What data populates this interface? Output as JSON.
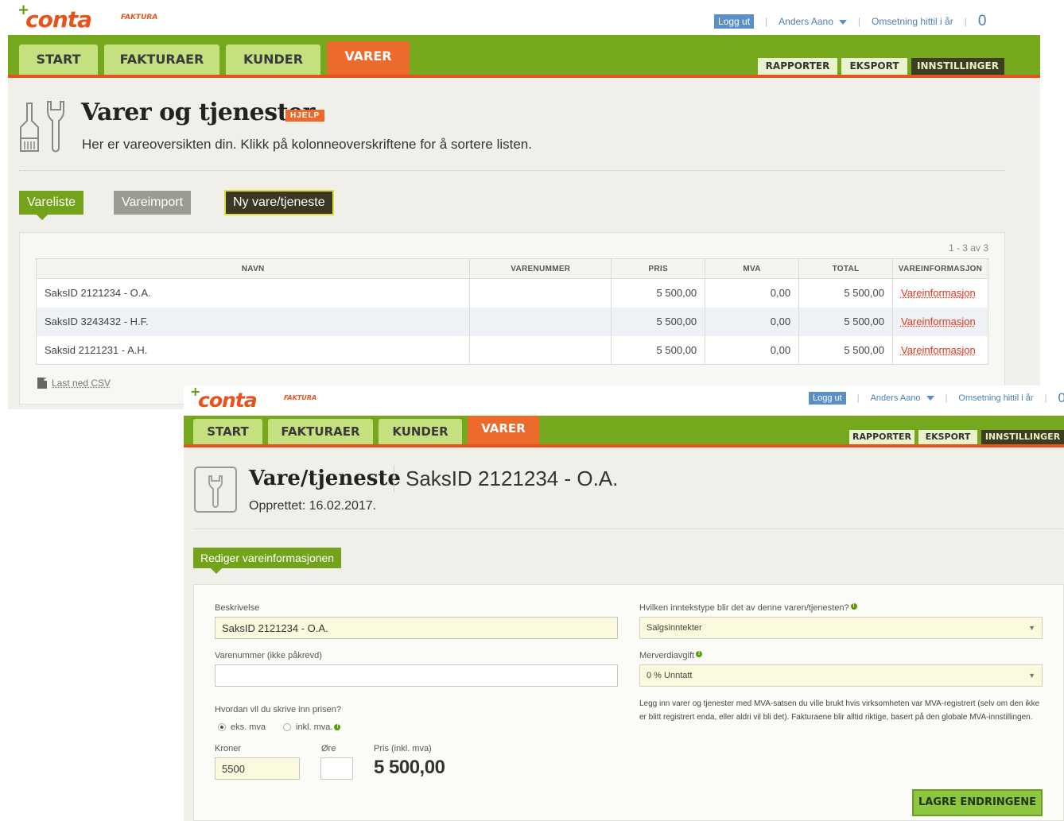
{
  "brand": {
    "logo_text": "conta",
    "logo_sub": "FAKTURA",
    "plus": "+"
  },
  "top": {
    "logout": "Logg ut",
    "user": "Anders Aano",
    "revenue_label": "Omsetning hittil i år",
    "revenue_count": "0"
  },
  "nav": {
    "tabs": [
      "START",
      "FAKTURAER",
      "KUNDER",
      "VARER"
    ],
    "active": "VARER",
    "right_tabs": [
      "RAPPORTER",
      "EKSPORT",
      "INNSTILLINGER"
    ]
  },
  "list_page": {
    "title": "Varer og tjenester",
    "help": "HJELP",
    "subtitle": "Her er vareoversikten din. Klikk på kolonneoverskriftene for å sortere listen.",
    "buttons": {
      "list": "Vareliste",
      "import": "Vareimport",
      "new": "Ny vare/tjeneste"
    },
    "pagination": "1 - 3 av 3",
    "columns": [
      "NAVN",
      "VARENUMMER",
      "PRIS",
      "MVA",
      "TOTAL",
      "VAREINFORMASJON"
    ],
    "rows": [
      {
        "name": "SaksID 2121234 - O.A.",
        "number": "",
        "price": "5 500,00",
        "vat": "0,00",
        "total": "5 500,00",
        "info": "Vareinformasjon"
      },
      {
        "name": "SaksID 3243432 - H.F.",
        "number": "",
        "price": "5 500,00",
        "vat": "0,00",
        "total": "5 500,00",
        "info": "Vareinformasjon"
      },
      {
        "name": "Saksid 2121231 - A.H.",
        "number": "",
        "price": "5 500,00",
        "vat": "0,00",
        "total": "5 500,00",
        "info": "Vareinformasjon"
      }
    ],
    "csv": "Last ned CSV"
  },
  "detail_page": {
    "title": "Vare/tjeneste",
    "item_name": "SaksID 2121234 - O.A.",
    "created": "Opprettet: 16.02.2017.",
    "edit_tab": "Rediger vareinformasjonen",
    "form": {
      "description_label": "Beskrivelse",
      "description_value": "SaksID 2121234 - O.A.",
      "number_label": "Varenummer (ikke påkrevd)",
      "number_value": "",
      "price_question": "Hvordan vil du skrive inn prisen?",
      "radio_ex": "eks. mva",
      "radio_incl": "inkl. mva.",
      "kroner_label": "Kroner",
      "kroner_value": "5500",
      "ore_label": "Øre",
      "ore_value": "",
      "price_incl_label": "Pris (inkl. mva)",
      "price_incl_value": "5 500,00",
      "income_label": "Hvilken inntekstype blir det av denne varen/tjenesten?",
      "income_value": "Salgsinntekter",
      "vat_label": "Merverdiavgift",
      "vat_value": "0 % Unntatt",
      "note": "Legg inn varer og tjenester med MVA-satsen du ville brukt hvis virksomheten var MVA-registrert (selv om den ikke er blitt registrert enda, eller aldri vil bli det). Fakturaene blir alltid riktige, basert på den globale MVA-innstillingen.",
      "save": "LAGRE ENDRINGENE"
    }
  },
  "colors": {
    "green": "#76a81e",
    "orange": "#ec6a2b",
    "tab_light": "#c5e07f",
    "link_red": "#d9381e"
  }
}
